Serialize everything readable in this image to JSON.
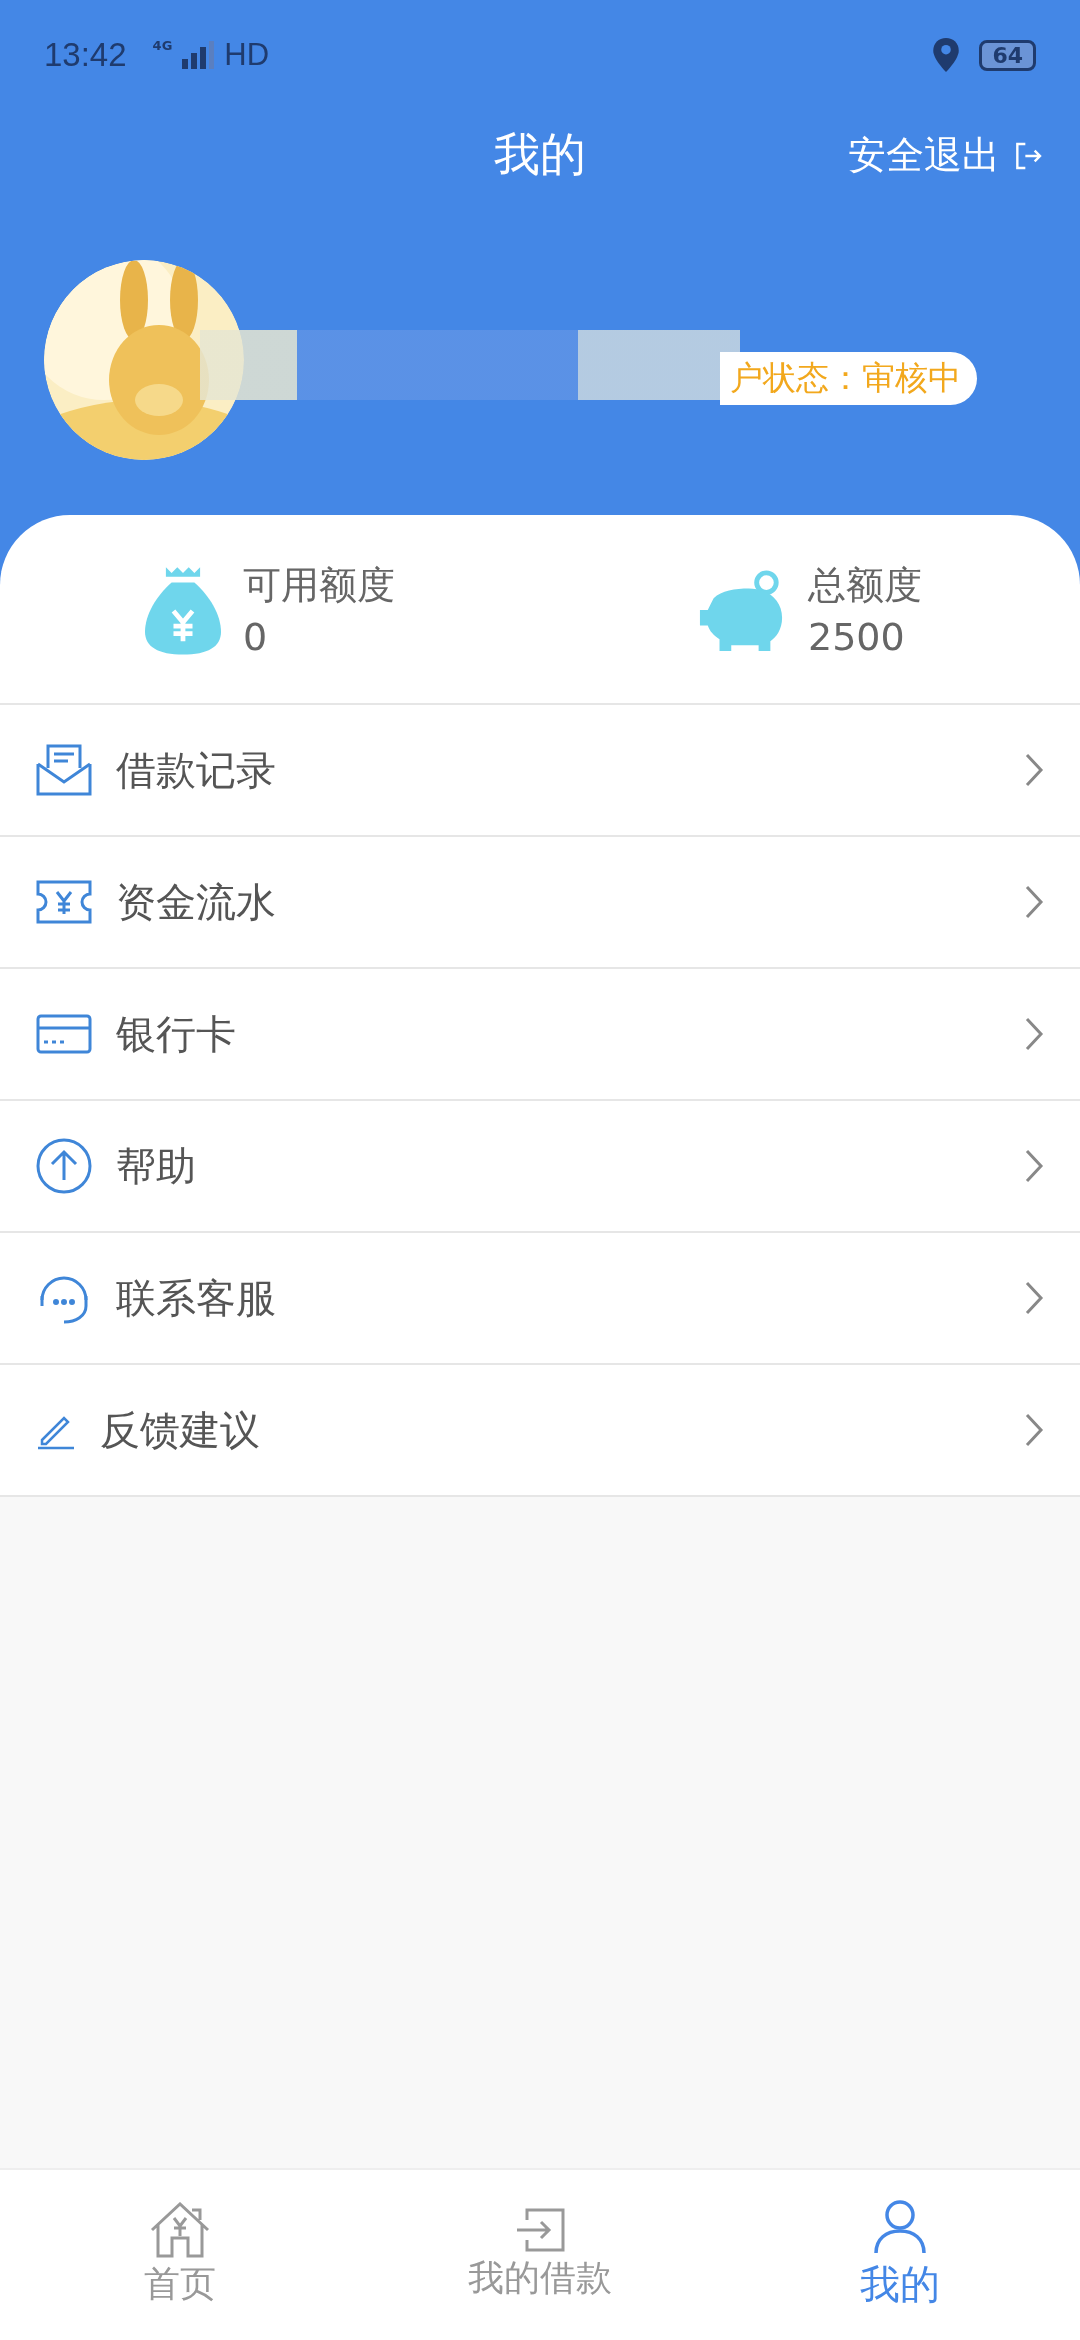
{
  "status_bar": {
    "time": "13:42",
    "network": "4G",
    "hd": "HD",
    "battery": "64"
  },
  "header": {
    "title": "我的",
    "logout": "安全退出"
  },
  "profile": {
    "status": "户状态：审核中"
  },
  "stats": [
    {
      "kind": "bag",
      "label": "可用额度",
      "value": "0"
    },
    {
      "kind": "pig",
      "label": "总额度",
      "value": "2500"
    }
  ],
  "menu": [
    {
      "kind": "envelope",
      "label": "借款记录"
    },
    {
      "kind": "ticket",
      "label": "资金流水"
    },
    {
      "kind": "card",
      "label": "银行卡"
    },
    {
      "kind": "up",
      "label": "帮助"
    },
    {
      "kind": "headset",
      "label": "联系客服"
    },
    {
      "kind": "pen",
      "label": "反馈建议"
    }
  ],
  "tabs": [
    {
      "kind": "home",
      "label": "首页",
      "selected": false
    },
    {
      "kind": "loan",
      "label": "我的借款",
      "selected": false
    },
    {
      "kind": "user",
      "label": "我的",
      "selected": true
    }
  ]
}
